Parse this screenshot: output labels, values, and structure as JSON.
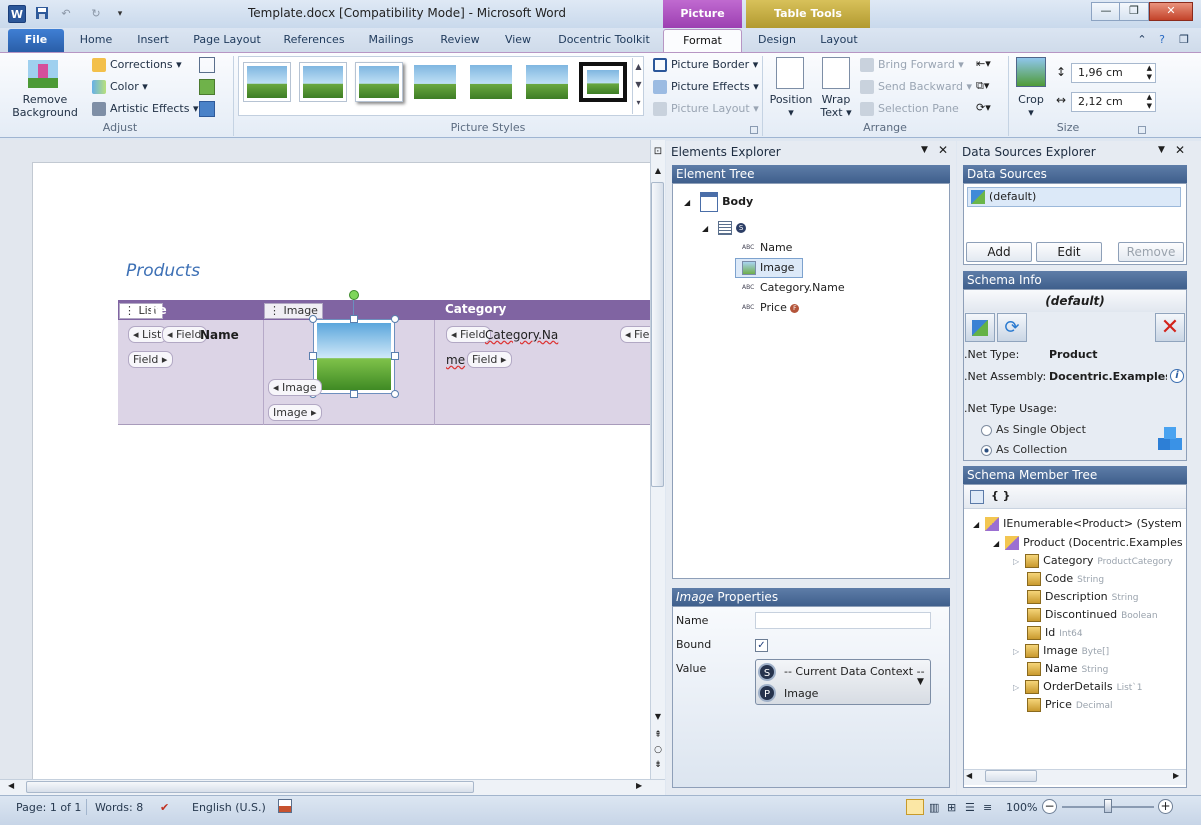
{
  "window": {
    "title": "Template.docx [Compatibility Mode] - Microsoft Word",
    "app_icon": "W"
  },
  "context_tabs": {
    "picture_tools": "Picture Tools",
    "table_tools": "Table Tools"
  },
  "tabs": {
    "file": "File",
    "home": "Home",
    "insert": "Insert",
    "page_layout": "Page Layout",
    "references": "References",
    "mailings": "Mailings",
    "review": "Review",
    "view": "View",
    "docentric": "Docentric Toolkit",
    "format": "Format",
    "design": "Design",
    "layout": "Layout"
  },
  "ribbon": {
    "adjust": {
      "remove_bg_1": "Remove",
      "remove_bg_2": "Background",
      "corrections": "Corrections",
      "color": "Color",
      "artistic": "Artistic Effects",
      "label": "Adjust"
    },
    "picture_styles": {
      "label": "Picture Styles",
      "border": "Picture Border",
      "effects": "Picture Effects",
      "layout": "Picture Layout"
    },
    "arrange": {
      "position": "Position",
      "wrap_1": "Wrap",
      "wrap_2": "Text",
      "bring_forward": "Bring Forward",
      "send_backward": "Send Backward",
      "selection_pane": "Selection Pane",
      "label": "Arrange"
    },
    "size": {
      "crop": "Crop",
      "height": "1,96 cm",
      "width": "2,12 cm",
      "label": "Size"
    }
  },
  "document": {
    "title": "Products",
    "header_name_partial": "ne",
    "header_image": "Image",
    "header_category": "Category",
    "list_tag": "List",
    "list_inline": "List",
    "field_tag": "Field",
    "name_text": "Name",
    "category_text_1": "Category.Na",
    "category_text_2": "me",
    "image_tag": "Image",
    "field_partial": "Field"
  },
  "elements_explorer": {
    "title": "Elements Explorer",
    "tree_header": "Element Tree",
    "body": "Body",
    "s_badge": "S",
    "items": [
      {
        "label": "Name"
      },
      {
        "label": "Image"
      },
      {
        "label": "Category.Name"
      },
      {
        "label": "Price"
      }
    ],
    "props_title_em": "Image",
    "props_title": "Properties",
    "name_label": "Name",
    "bound_label": "Bound",
    "value_label": "Value",
    "value_context": "-- Current Data Context --",
    "value_prop": "Image",
    "badge_s": "S",
    "badge_p": "P",
    "badge_f": "F"
  },
  "data_sources": {
    "title": "Data Sources Explorer",
    "sources_header": "Data Sources",
    "default_source": "(default)",
    "add": "Add",
    "edit": "Edit",
    "remove": "Remove",
    "schema_header": "Schema Info",
    "schema_title": "(default)",
    "net_type_label": ".Net Type:",
    "net_type_value": "Product",
    "net_assembly_label": ".Net Assembly:",
    "net_assembly_value": "Docentric.Examples.Da",
    "usage_label": ".Net Type Usage:",
    "single": "As Single Object",
    "collection": "As Collection",
    "member_header": "Schema Member Tree",
    "braces": "{ }",
    "root": "IEnumerable<Product> (System.Cc",
    "product": "Product (Docentric.Examples.D",
    "members": [
      {
        "name": "Category",
        "type": "ProductCategory"
      },
      {
        "name": "Code",
        "type": "String"
      },
      {
        "name": "Description",
        "type": "String"
      },
      {
        "name": "Discontinued",
        "type": "Boolean"
      },
      {
        "name": "Id",
        "type": "Int64"
      },
      {
        "name": "Image",
        "type": "Byte[]"
      },
      {
        "name": "Name",
        "type": "String"
      },
      {
        "name": "OrderDetails",
        "type": "List`1"
      },
      {
        "name": "Price",
        "type": "Decimal"
      }
    ]
  },
  "status": {
    "page": "Page: 1 of 1",
    "words": "Words: 8",
    "language": "English (U.S.)",
    "zoom": "100%"
  },
  "colors": {
    "accent": "#2b579a",
    "table_header": "#8064a2",
    "picture_tools": "#9c3fb1",
    "table_tools": "#b29a30"
  }
}
